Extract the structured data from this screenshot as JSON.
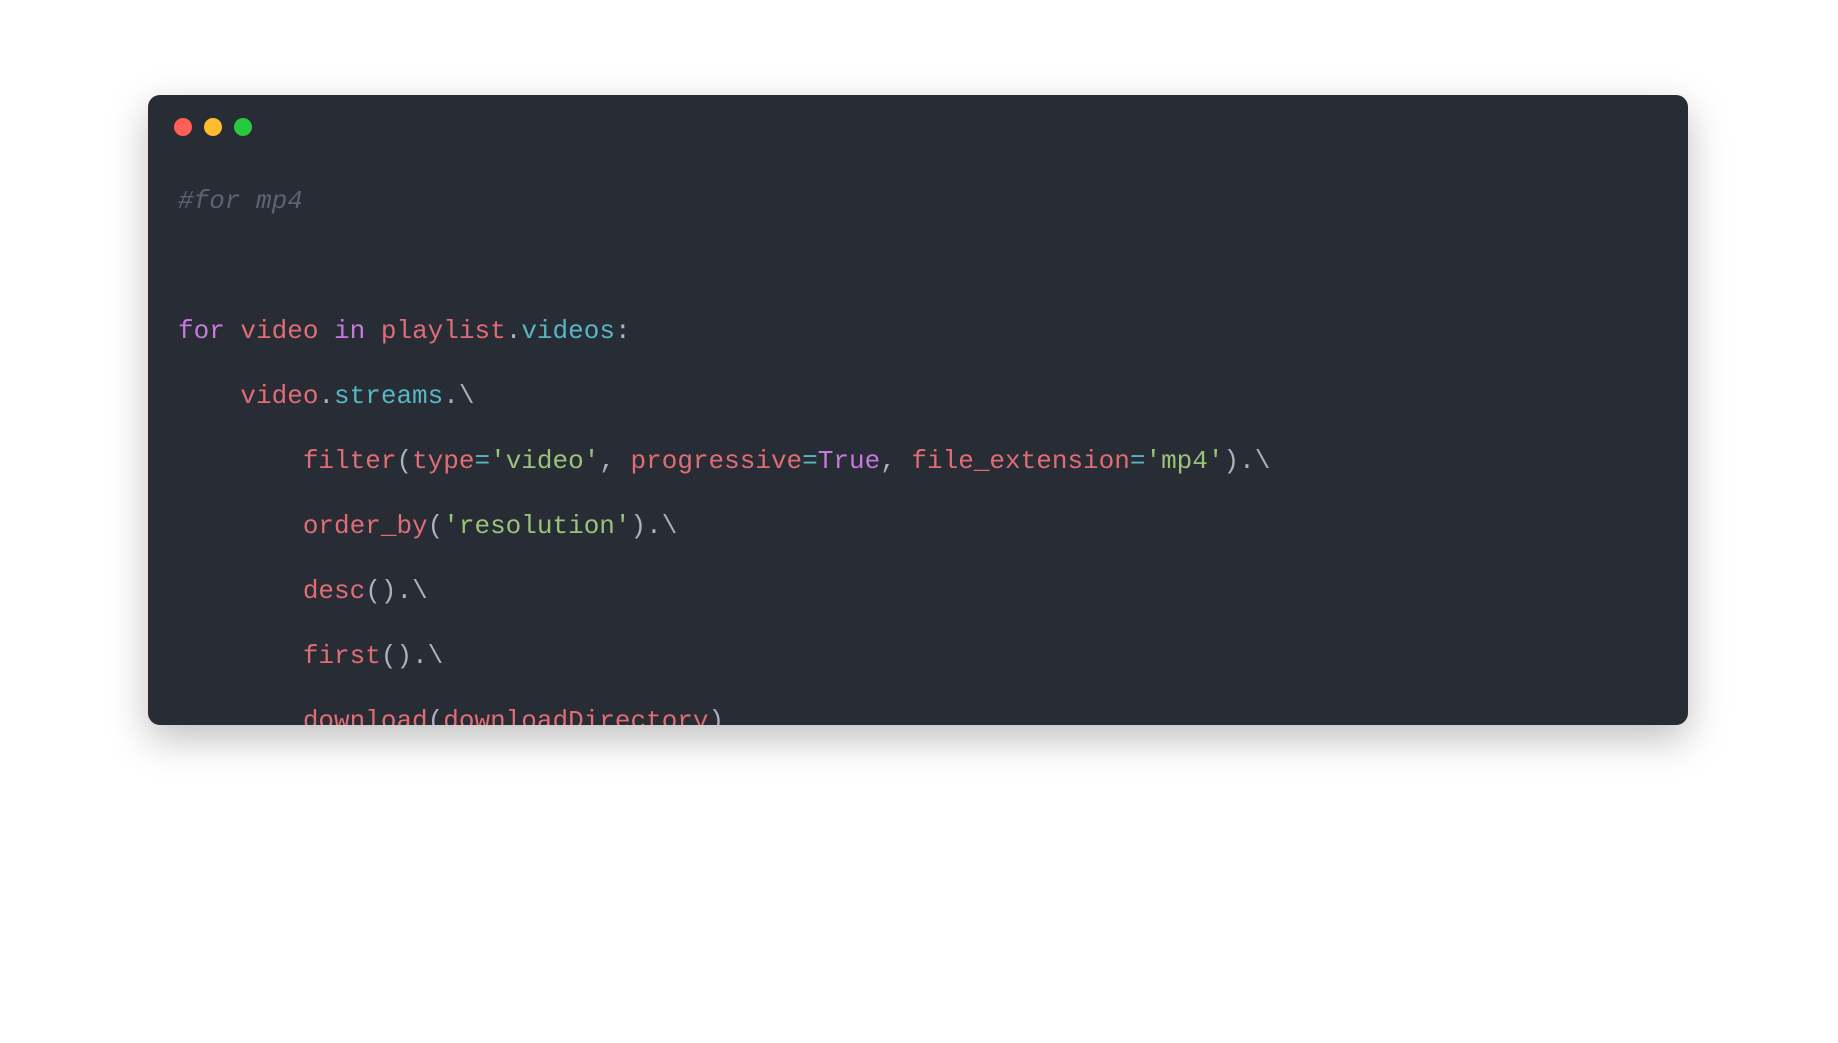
{
  "window": {
    "traffic_lights": {
      "close": "#ff5f56",
      "min": "#ffbd2e",
      "max": "#27c93f"
    }
  },
  "code": {
    "comment": "#for mp4",
    "kw_for": "for",
    "for_var": "video",
    "kw_in": "in",
    "iter_obj": "playlist",
    "iter_attr": "videos",
    "colon": ":",
    "body_obj": "video",
    "body_attr": "streams",
    "cont": "\\",
    "fn_filter": "filter",
    "p_type": "type",
    "v_video": "'video'",
    "p_prog": "progressive",
    "v_true": "True",
    "p_ext": "file_extension",
    "v_mp4": "'mp4'",
    "fn_order": "order_by",
    "v_res": "'resolution'",
    "fn_desc": "desc",
    "fn_first": "first",
    "fn_download": "download",
    "arg_dir": "downloadDirectory",
    "lp": "(",
    "rp": ")",
    "comma": ", ",
    "eq": "=",
    "dot": ".",
    "indent1": "    ",
    "indent2": "        "
  }
}
